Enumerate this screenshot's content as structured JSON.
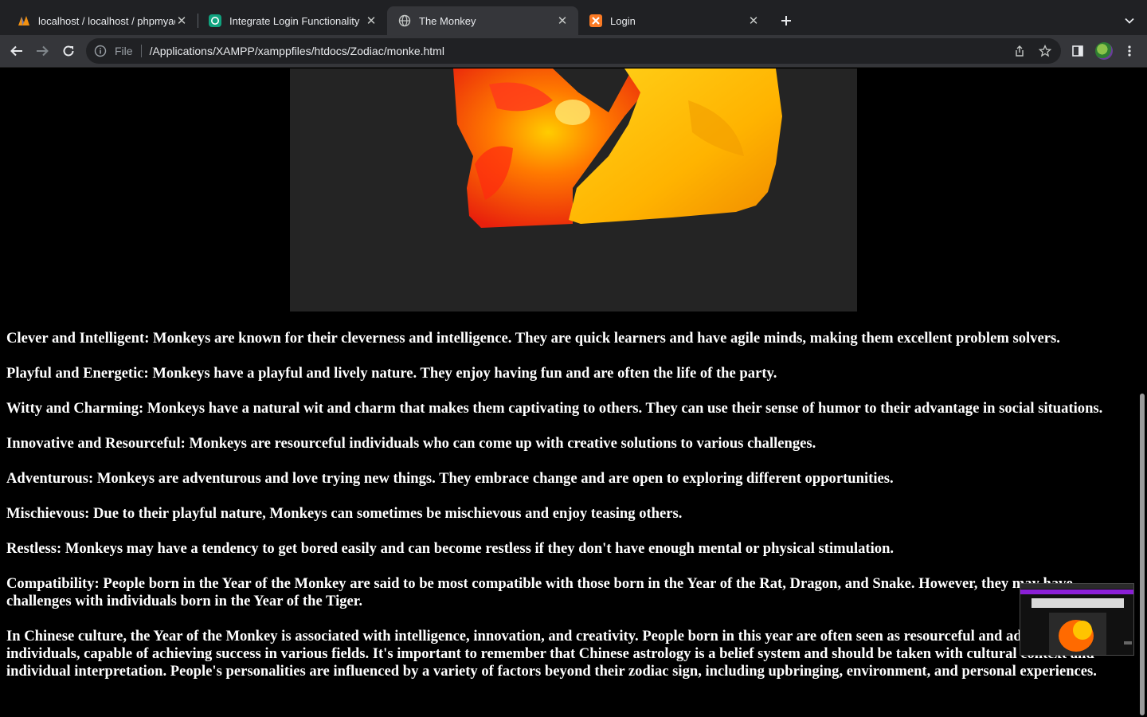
{
  "browser": {
    "tabs": [
      {
        "title": "localhost / localhost / phpmyadmin",
        "icon": "phpmyadmin-icon",
        "active": false
      },
      {
        "title": "Integrate Login Functionality",
        "icon": "chatgpt-icon",
        "active": false
      },
      {
        "title": "The Monkey",
        "icon": "globe-icon",
        "active": true
      },
      {
        "title": "Login",
        "icon": "xampp-icon",
        "active": false
      }
    ],
    "new_tab_icon": "plus-icon",
    "tab_list_icon": "chevron-down-icon",
    "address_bar": {
      "scheme_label": "File",
      "url": "/Applications/XAMPP/xamppfiles/htdocs/Zodiac/monke.html"
    }
  },
  "page": {
    "hero_image": {
      "subject": "fire monkey artwork",
      "colors": [
        "#ff3b1a",
        "#ff8a00",
        "#ffc400"
      ]
    },
    "traits": [
      "Clever and Intelligent: Monkeys are known for their cleverness and intelligence. They are quick learners and have agile minds, making them excellent problem solvers.",
      "Playful and Energetic: Monkeys have a playful and lively nature. They enjoy having fun and are often the life of the party.",
      "Witty and Charming: Monkeys have a natural wit and charm that makes them captivating to others. They can use their sense of humor to their advantage in social situations.",
      "Innovative and Resourceful: Monkeys are resourceful individuals who can come up with creative solutions to various challenges.",
      "Adventurous: Monkeys are adventurous and love trying new things. They embrace change and are open to exploring different opportunities.",
      "Mischievous: Due to their playful nature, Monkeys can sometimes be mischievous and enjoy teasing others.",
      "Restless: Monkeys may have a tendency to get bored easily and can become restless if they don't have enough mental or physical stimulation.",
      "Compatibility: People born in the Year of the Monkey are said to be most compatible with those born in the Year of the Rat, Dragon, and Snake. However, they may have challenges with individuals born in the Year of the Tiger.",
      "In Chinese culture, the Year of the Monkey is associated with intelligence, innovation, and creativity. People born in this year are often seen as resourceful and adaptable individuals, capable of achieving success in various fields. It's important to remember that Chinese astrology is a belief system and should be taken with cultural context and individual interpretation. People's personalities are influenced by a variety of factors beyond their zodiac sign, including upbringing, environment, and personal experiences."
    ]
  },
  "colors": {
    "tab_strip": "#202124",
    "toolbar": "#35363a",
    "page_background": "#000000",
    "page_text": "#ffffff"
  }
}
